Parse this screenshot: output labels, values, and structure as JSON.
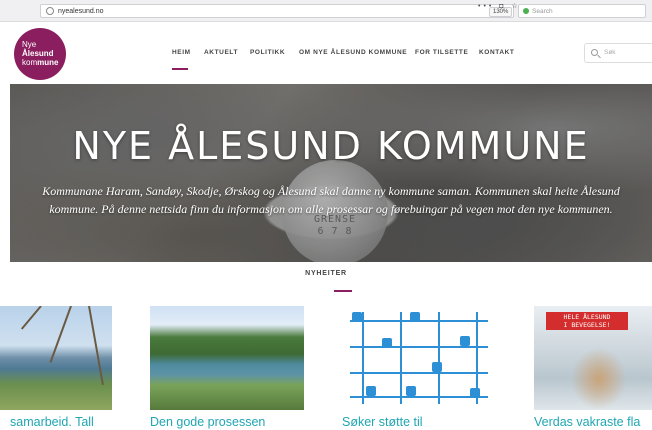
{
  "browser": {
    "url": "nyealesund.no",
    "zoom": "130%",
    "toolbar_icons": "••• ◘ ☆",
    "search_placeholder": "Search"
  },
  "site": {
    "logo_line1": "Nye",
    "logo_line2": "Ålesund",
    "logo_line3_prefix": "kom",
    "logo_line3_bold": "mune",
    "brand_color": "#8a1e5e",
    "accent_color": "#1fa6b3"
  },
  "nav": {
    "items": [
      {
        "label": "HEIM",
        "active": true
      },
      {
        "label": "AKTUELT"
      },
      {
        "label": "POLITIKK"
      },
      {
        "label": "OM NYE ÅLESUND KOMMUNE"
      },
      {
        "label": "FOR TILSETTE"
      },
      {
        "label": "KONTAKT"
      }
    ],
    "search_placeholder": "Søk"
  },
  "hero": {
    "title": "NYE ÅLESUND KOMMUNE",
    "text_line1": "Kommunane Haram, Sandøy, Skodje, Ørskog og Ålesund skal danne ny kommune saman. Kommunen skal heite Ålesund",
    "text_line2": "kommune. På denne nettsida finn du informasjon om alle prosessar og førebuingar på vegen mot den nye kommunen.",
    "stone_line1": "GRENSE",
    "stone_line2": "6 7 8"
  },
  "news": {
    "heading": "NYHEITER",
    "cards": [
      {
        "caption": "samarbeid. Tall"
      },
      {
        "caption": "Den gode prosessen"
      },
      {
        "caption": "Søker støtte til"
      },
      {
        "caption": "Verdas vakraste fla"
      }
    ],
    "card4_banner_line1": "HELE ÅLESUND",
    "card4_banner_line2": "I BEVEGELSE!"
  }
}
